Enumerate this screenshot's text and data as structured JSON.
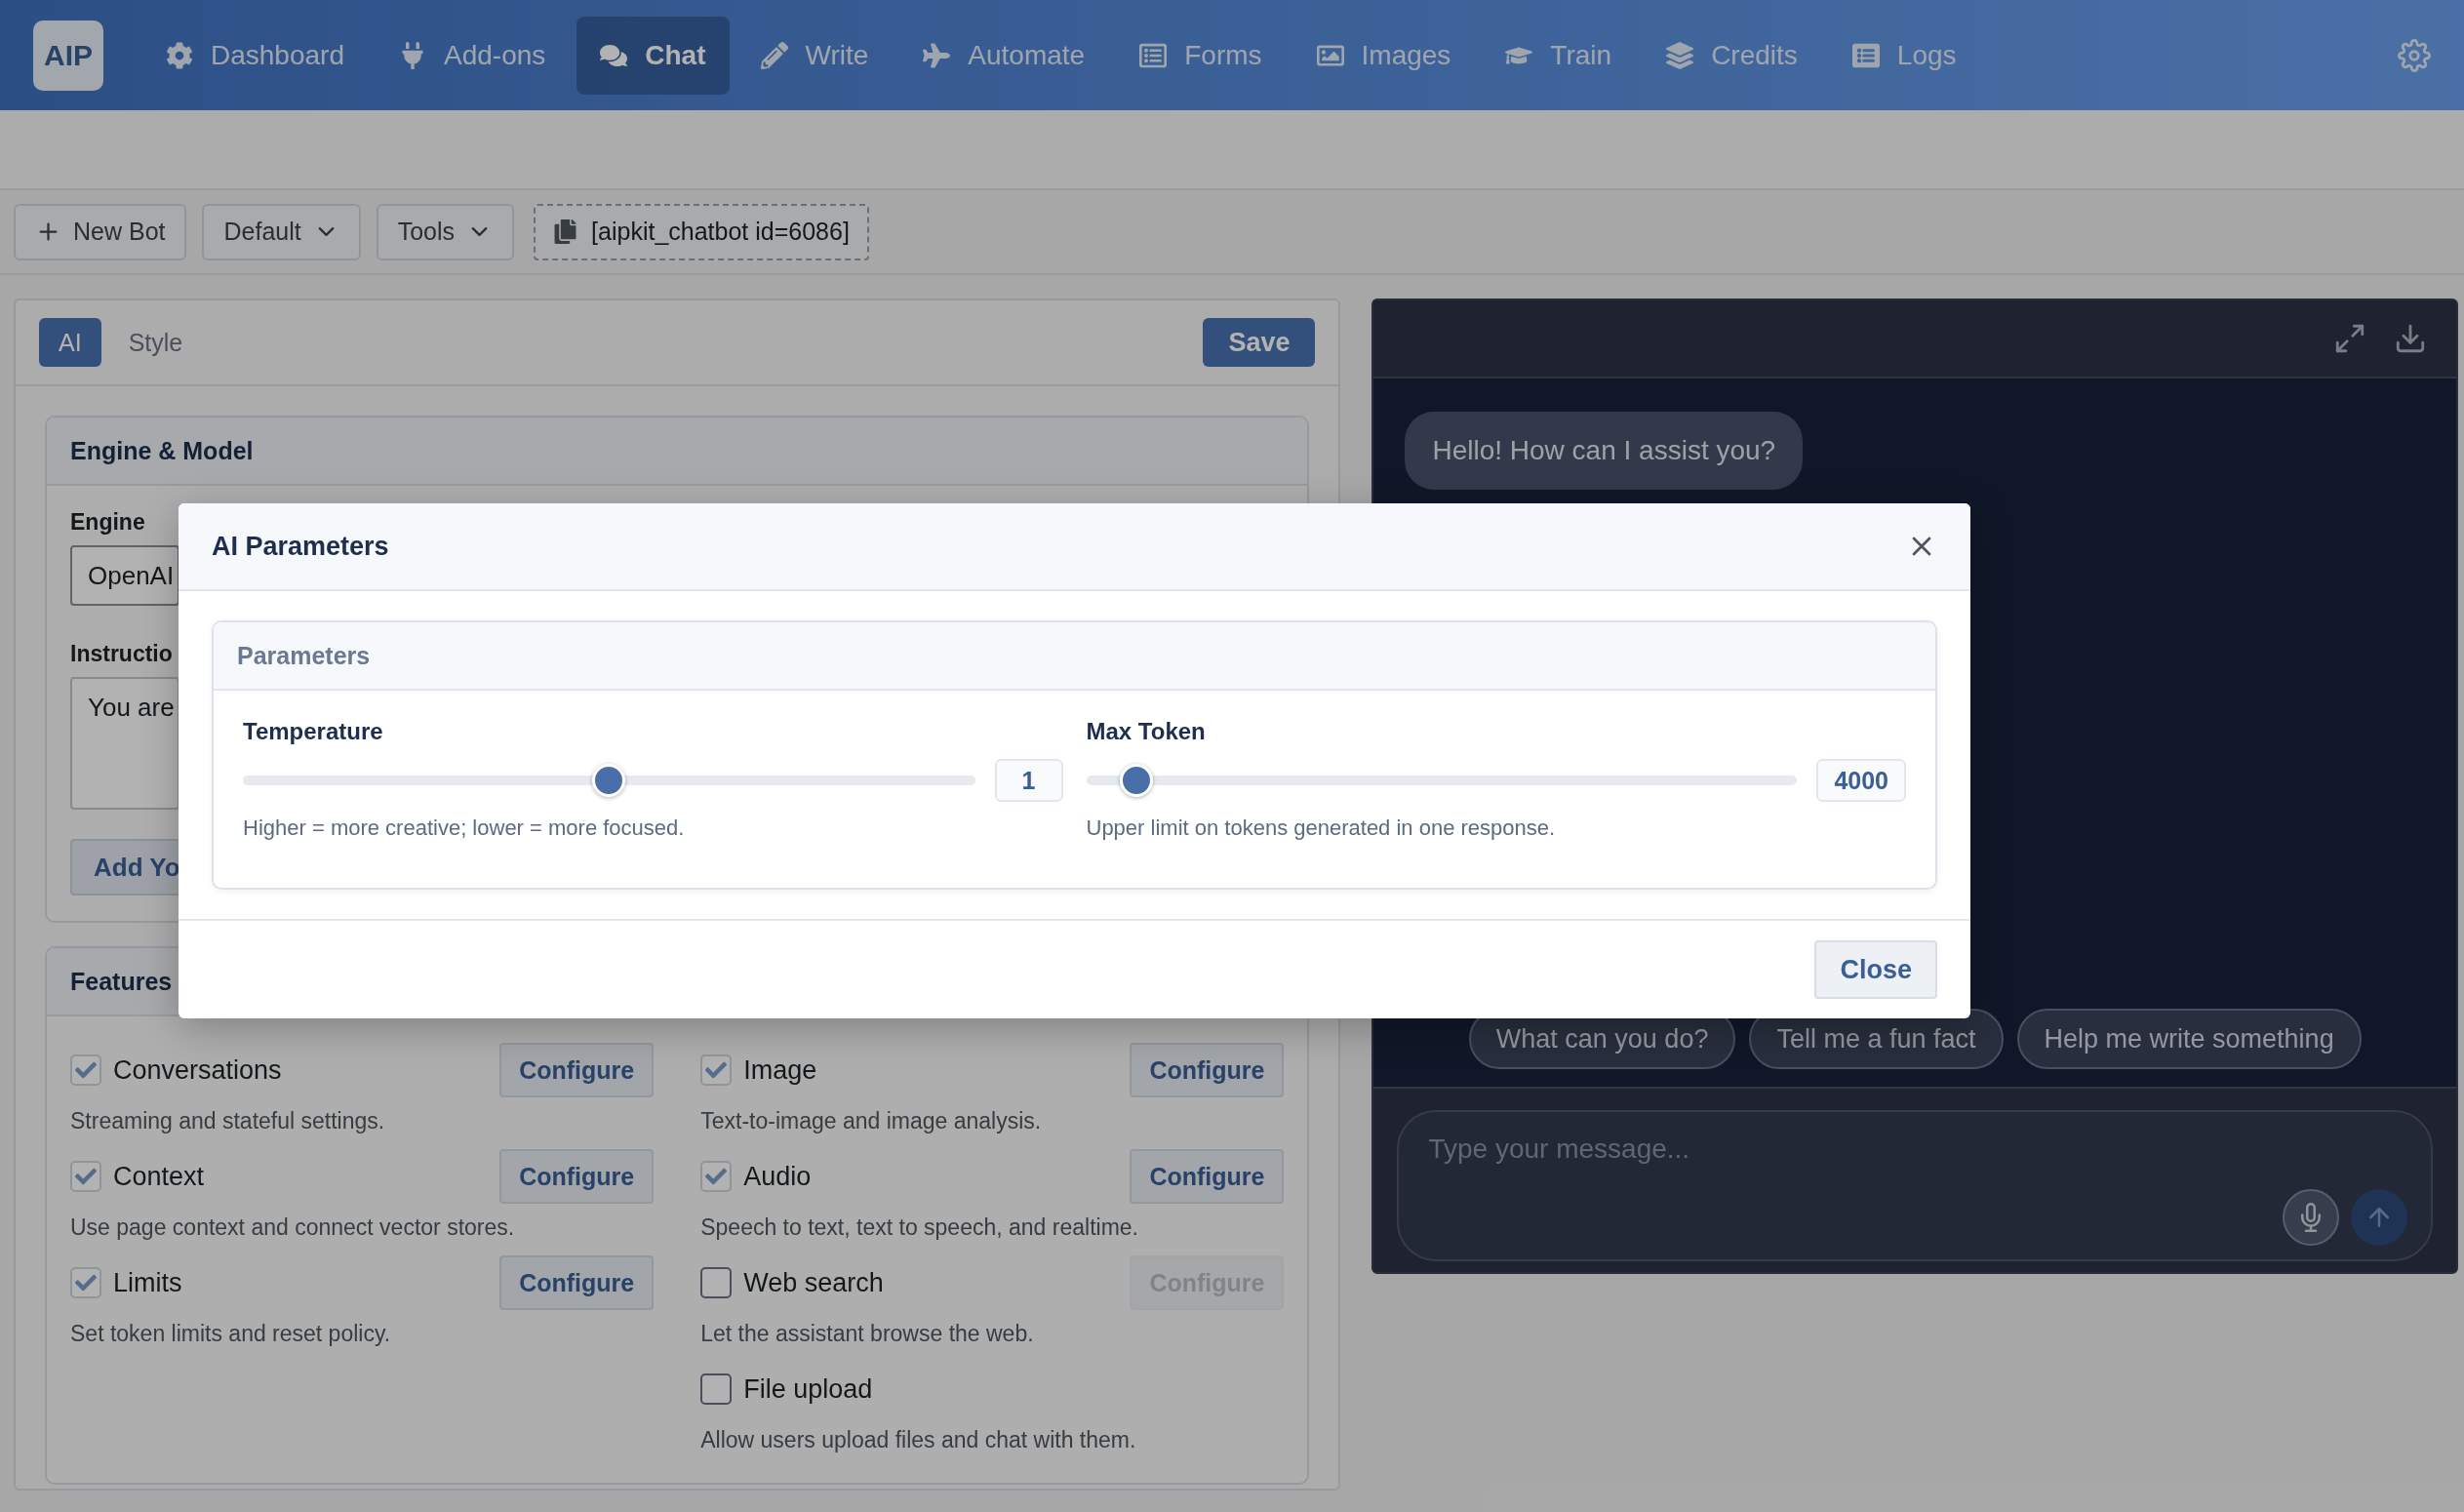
{
  "nav": {
    "logo": "AIP",
    "items": [
      {
        "label": "Dashboard",
        "selected": false
      },
      {
        "label": "Add-ons",
        "selected": false
      },
      {
        "label": "Chat",
        "selected": true
      },
      {
        "label": "Write",
        "selected": false
      },
      {
        "label": "Automate",
        "selected": false
      },
      {
        "label": "Forms",
        "selected": false
      },
      {
        "label": "Images",
        "selected": false
      },
      {
        "label": "Train",
        "selected": false
      },
      {
        "label": "Credits",
        "selected": false
      },
      {
        "label": "Logs",
        "selected": false
      }
    ]
  },
  "toolbar": {
    "new_bot": "New Bot",
    "template": "Default",
    "tools": "Tools",
    "shortcode": "[aipkit_chatbot id=6086]"
  },
  "editor": {
    "tabs": [
      {
        "label": "AI",
        "selected": true
      },
      {
        "label": "Style",
        "selected": false
      }
    ],
    "save": "Save",
    "engine_card": {
      "title": "Engine & Model",
      "engine_label": "Engine",
      "engine_value": "OpenAI",
      "instructions_label": "Instructio",
      "instructions_value": "You are",
      "add_button": "Add Yo"
    },
    "features": {
      "title": "Features",
      "columns": [
        [
          {
            "label": "Conversations",
            "description": "Streaming and stateful settings.",
            "checked": true,
            "configure": {
              "label": "Configure",
              "disabled": false
            }
          },
          {
            "label": "Context",
            "description": "Use page context and connect vector stores.",
            "checked": true,
            "configure": {
              "label": "Configure",
              "disabled": false
            }
          },
          {
            "label": "Limits",
            "description": "Set token limits and reset policy.",
            "checked": true,
            "configure": {
              "label": "Configure",
              "disabled": false
            }
          }
        ],
        [
          {
            "label": "Image",
            "description": "Text-to-image and image analysis.",
            "checked": true,
            "configure": {
              "label": "Configure",
              "disabled": false
            }
          },
          {
            "label": "Audio",
            "description": "Speech to text, text to speech, and realtime.",
            "checked": true,
            "configure": {
              "label": "Configure",
              "disabled": false
            }
          },
          {
            "label": "Web search",
            "description": "Let the assistant browse the web.",
            "checked": false,
            "configure": {
              "label": "Configure",
              "disabled": true
            }
          },
          {
            "label": "File upload",
            "description": "Allow users upload files and chat with them.",
            "checked": false
          }
        ]
      ]
    }
  },
  "chat_preview": {
    "greeting": "Hello! How can I assist you?",
    "suggestions": [
      "What can you do?",
      "Tell me a fun fact",
      "Help me write something"
    ],
    "input": {
      "placeholder": "Type your message..."
    }
  },
  "modal": {
    "title": "AI Parameters",
    "section": "Parameters",
    "params": [
      {
        "label": "Temperature",
        "level": 0.5,
        "value": "1",
        "hint": "Higher = more creative; lower = more focused."
      },
      {
        "label": "Max Token",
        "level": 0.05,
        "value": "4000",
        "hint": "Upper limit on tokens generated in one response."
      }
    ],
    "close": "Close"
  }
}
